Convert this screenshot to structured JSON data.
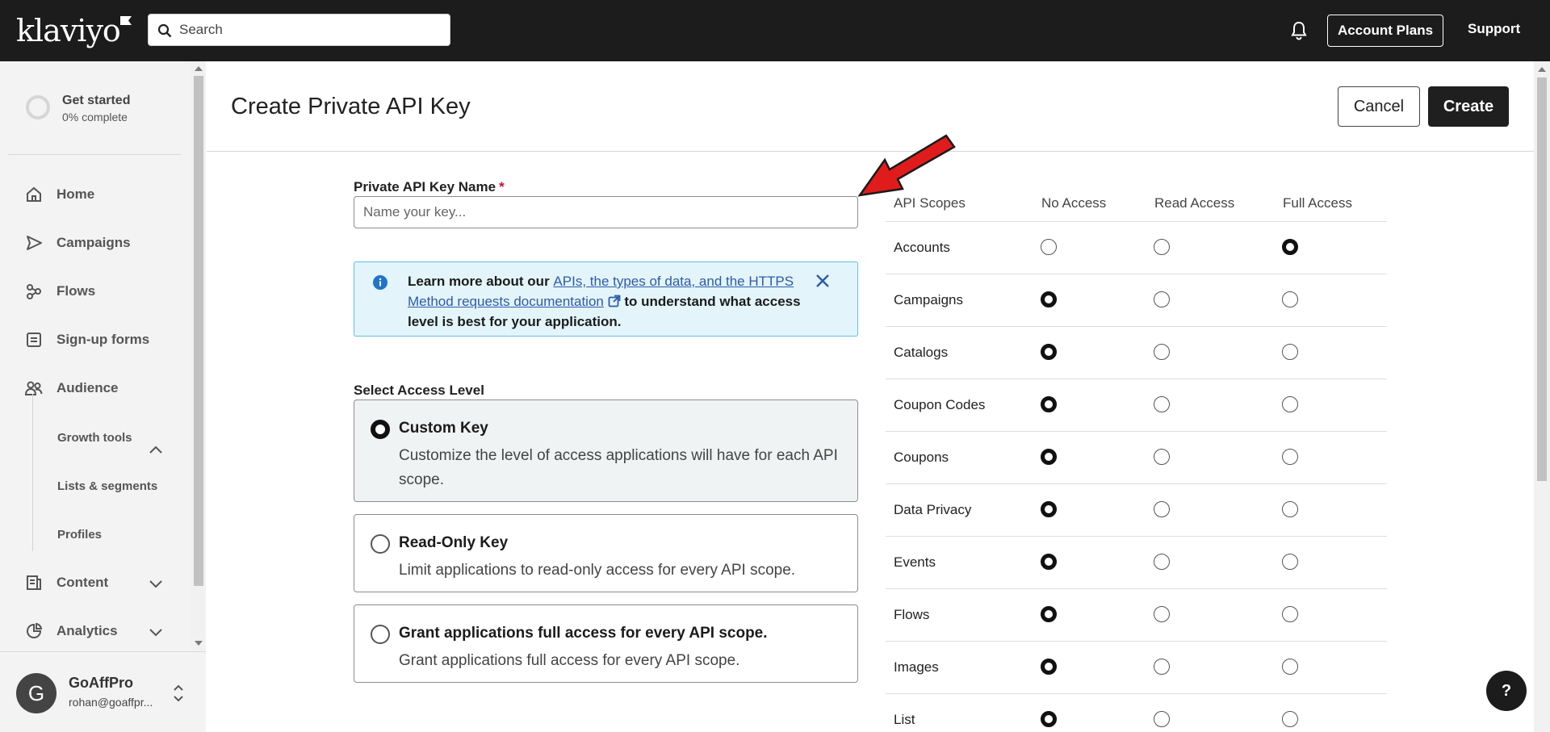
{
  "app": {
    "logo_text": "klaviyo"
  },
  "header": {
    "search_placeholder": "Search",
    "account_plans_label": "Account Plans",
    "support_label": "Support"
  },
  "sidebar": {
    "get_started": {
      "title": "Get started",
      "progress_text": "0% complete",
      "progress": 0
    },
    "items": [
      {
        "label": "Home",
        "icon": "home-icon"
      },
      {
        "label": "Campaigns",
        "icon": "send-icon"
      },
      {
        "label": "Flows",
        "icon": "flows-icon"
      },
      {
        "label": "Sign-up forms",
        "icon": "form-icon"
      },
      {
        "label": "Audience",
        "icon": "people-icon",
        "expanded": true
      },
      {
        "label": "Content",
        "icon": "content-icon",
        "expanded": false
      },
      {
        "label": "Analytics",
        "icon": "analytics-icon",
        "expanded": false
      }
    ],
    "audience_sub": [
      "Growth tools",
      "Lists & segments",
      "Profiles"
    ],
    "user": {
      "initial": "G",
      "name": "GoAffPro",
      "email": "rohan@goaffpr..."
    }
  },
  "page": {
    "title": "Create Private API Key",
    "cancel_label": "Cancel",
    "create_label": "Create"
  },
  "form": {
    "key_name_label": "Private API Key Name",
    "required_mark": "*",
    "key_name_value": "",
    "key_name_placeholder": "Name your key...",
    "info": {
      "prefix": "Learn more about our",
      "link": "APIs, the types of data, and the HTTPS Method requests documentation",
      "suffix": "to understand what access level is best for your application."
    },
    "access_level_label": "Select Access Level",
    "options": [
      {
        "title": "Custom Key",
        "description": "Customize the level of access applications will have for each API scope.",
        "selected": true
      },
      {
        "title": "Read-Only Key",
        "description": "Limit applications to read-only access for every API scope.",
        "selected": false
      },
      {
        "title": "Grant applications full access for every API scope.",
        "description": "Grant applications full access for every API scope.",
        "selected": false
      }
    ]
  },
  "scopes": {
    "headers": [
      "API Scopes",
      "No Access",
      "Read Access",
      "Full Access"
    ],
    "rows": [
      {
        "name": "Accounts",
        "selected": "Full Access"
      },
      {
        "name": "Campaigns",
        "selected": "No Access"
      },
      {
        "name": "Catalogs",
        "selected": "No Access"
      },
      {
        "name": "Coupon Codes",
        "selected": "No Access"
      },
      {
        "name": "Coupons",
        "selected": "No Access"
      },
      {
        "name": "Data Privacy",
        "selected": "No Access"
      },
      {
        "name": "Events",
        "selected": "No Access"
      },
      {
        "name": "Flows",
        "selected": "No Access"
      },
      {
        "name": "Images",
        "selected": "No Access"
      },
      {
        "name": "List",
        "selected": "No Access"
      }
    ]
  },
  "help_label": "?",
  "colors": {
    "topbar": "#1c1c1c",
    "annotation_arrow": "#e01b1b",
    "info_bg": "#e3f5fb",
    "link": "#2e5aa8"
  }
}
